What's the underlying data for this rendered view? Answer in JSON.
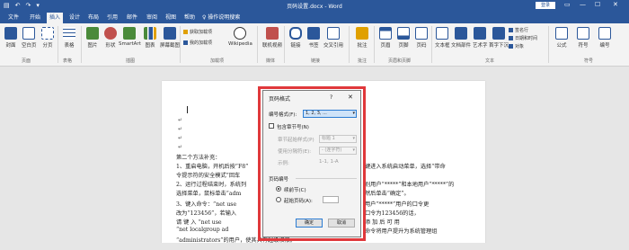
{
  "window": {
    "title": "页码设置.docx - Word",
    "login": "登录",
    "qat": [
      "▤",
      "↶",
      "↷",
      "▾"
    ],
    "controls": [
      "▭",
      "—",
      "☐",
      "✕"
    ]
  },
  "tabs": [
    "文件",
    "开始",
    "插入",
    "设计",
    "布局",
    "引用",
    "邮件",
    "审阅",
    "视图",
    "帮助"
  ],
  "tell_me": "♀ 操作说明搜索",
  "ribbon": {
    "buttons": [
      {
        "label": "封面",
        "color": "#2b579a"
      },
      {
        "label": "空白页",
        "color": "#2b579a"
      },
      {
        "label": "分页",
        "color": "#2b579a"
      },
      {
        "label": "表格",
        "color": "#2b579a"
      },
      {
        "label": "图片",
        "color": "#4a8a3a"
      },
      {
        "label": "形状",
        "color": "#c0504d"
      },
      {
        "label": "SmartArt",
        "color": "#4a8a3a"
      },
      {
        "label": "图表",
        "color": "#4a8a3a"
      },
      {
        "label": "屏幕截图",
        "color": "#2b579a"
      },
      {
        "label": "Wikipedia",
        "color": "#333333"
      },
      {
        "label": "联机视频",
        "color": "#c0504d"
      },
      {
        "label": "链接",
        "color": "#2b579a"
      },
      {
        "label": "书签",
        "color": "#2b579a"
      },
      {
        "label": "交叉引用",
        "color": "#2b579a"
      },
      {
        "label": "批注",
        "color": "#e0a000"
      },
      {
        "label": "页眉",
        "color": "#2b579a"
      },
      {
        "label": "页脚",
        "color": "#2b579a"
      },
      {
        "label": "页码",
        "color": "#2b579a"
      },
      {
        "label": "文本框",
        "color": "#2b579a"
      },
      {
        "label": "文档部件",
        "color": "#2b579a"
      },
      {
        "label": "艺术字",
        "color": "#2b579a"
      },
      {
        "label": "首字下沉",
        "color": "#2b579a"
      },
      {
        "label": "公式",
        "color": "#2b579a"
      },
      {
        "label": "符号",
        "color": "#2b579a"
      },
      {
        "label": "编号",
        "color": "#2b579a"
      }
    ],
    "small_items": {
      "get_addins": "获取加载项",
      "my_addins": "我的加载项",
      "signature": "签名行",
      "datetime": "日期和时间",
      "object": "对象"
    },
    "groups": [
      "页面",
      "表格",
      "插图",
      "加载项",
      "媒体",
      "链接",
      "批注",
      "页眉和页脚",
      "文本",
      "符号"
    ]
  },
  "document": {
    "lines": [
      "第二个方法补充：",
      "1、重启电脑，开机后按“F8”",
      "    令提示符的安全模式”回车",
      "2、运行过程结束时，系统列",
      "    选择菜单，鼠标单击“adm",
      "3、键入命令：“net  use",
      "    改为“123456”，若输入",
      "    请  键  入  “net  use",
      "    “net  localgroup  ad",
      "    “administrators”的用户，使其具有超级权限。"
    ],
    "right_fragments": [
      "键进入系统启动菜单，选择“带命",
      "别用户“*****”和本地用户“*****”的",
      "然后单击“确定”。",
      "用户“*****”用户的口令更",
      "口令为123456的话，",
      "添  加  后  可  用",
      "命令将用户提升为系统管理组"
    ]
  },
  "dialog": {
    "title": "页码格式",
    "help": "?",
    "close": "✕",
    "format_label": "编号格式(F):",
    "format_value": "1, 2, 3, ...",
    "include_chapter": "包含章节号(N)",
    "chapter_style_label": "章节起始样式(P)",
    "chapter_style_value": "标题 1",
    "separator_label": "使用分隔符(E):",
    "separator_value": "- (连字符)",
    "example_label": "示例:",
    "example_value": "1-1, 1-A",
    "page_numbering": "页码编号",
    "continue_label": "续前节(C)",
    "start_at_label": "起始页码(A):",
    "ok": "确定",
    "cancel": "取消",
    "highlight_color": "#e0383b"
  }
}
